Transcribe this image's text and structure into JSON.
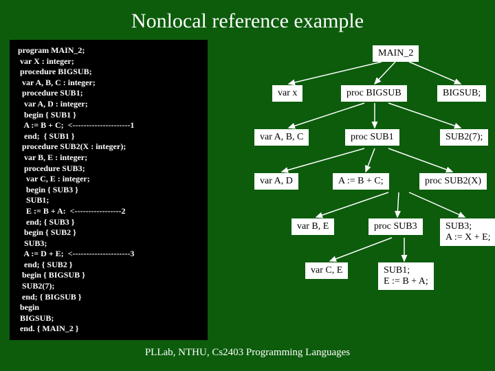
{
  "title": "Nonlocal reference example",
  "code": "program MAIN_2;\n var X : integer;\n procedure BIGSUB;\n  var A, B, C : integer;\n  procedure SUB1;\n   var A, D : integer;\n   begin { SUB1 }\n   A := B + C;  <---------------------1\n   end;  { SUB1 }\n  procedure SUB2(X : integer);\n   var B, E : integer;\n   procedure SUB3;\n    var C, E : integer;\n    begin { SUB3 }\n    SUB1;\n    E := B + A:  <-----------------2\n    end; { SUB3 }\n   begin { SUB2 }\n   SUB3;\n   A := D + E;  <---------------------3\n   end; { SUB2 }\n  begin { BIGSUB }\n  SUB2(7);\n  end; { BIGSUB }\n begin\n BIGSUB;\n end. { MAIN_2 }",
  "nodes": {
    "main2": "MAIN_2",
    "varx": "var x",
    "procbigsub": "proc BIGSUB",
    "bigsub": "BIGSUB;",
    "varabc": "var A, B, C",
    "procsub1": "proc SUB1",
    "sub2_7": "SUB2(7);",
    "varad": "var A, D",
    "abc": "A := B + C;",
    "procsub2x": "proc SUB2(X)",
    "varbe": "var B, E",
    "procsub3": "proc SUB3",
    "sub3stmt": "SUB3;\nA := X + E;",
    "varce": "var C, E",
    "sub1stmt": "SUB1;\nE := B + A;"
  },
  "footer": "PLLab, NTHU, Cs2403 Programming Languages"
}
